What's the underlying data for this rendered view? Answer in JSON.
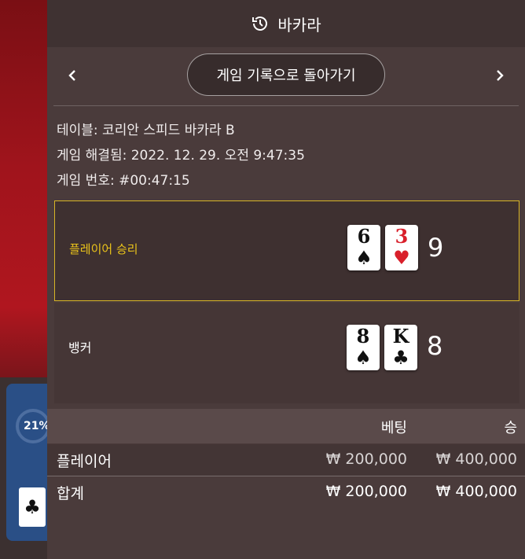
{
  "header": {
    "title": "바카라",
    "icon": "history-icon"
  },
  "nav": {
    "back_label": "게임 기록으로 돌아가기",
    "prev_icon": "chevron-left-icon",
    "next_icon": "chevron-right-icon"
  },
  "info": {
    "table": "테이블: 코리안 스피드 바카라 B",
    "resolved": "게임 해결됨: 2022. 12. 29. 오전 9:47:35",
    "game_number": "게임 번호: #00:47:15"
  },
  "player": {
    "label": "플레이어 승리",
    "cards": [
      {
        "rank": "6",
        "suit": "♠"
      },
      {
        "rank": "3",
        "suit": "♥"
      }
    ],
    "total": "9"
  },
  "banker": {
    "label": "뱅커",
    "cards": [
      {
        "rank": "8",
        "suit": "♠"
      },
      {
        "rank": "K",
        "suit": "♣"
      }
    ],
    "total": "8"
  },
  "bets": {
    "col_bet": "베팅",
    "col_win": "승",
    "rows": [
      {
        "label": "플레이어",
        "bet": "₩ 200,000",
        "win": "₩ 400,000"
      },
      {
        "label": "합계",
        "bet": "₩ 200,000",
        "win": "₩ 400,000"
      }
    ]
  },
  "background": {
    "percent": "21%",
    "card_suit": "♣"
  },
  "colors": {
    "winner_border": "#d8b526",
    "winner_text": "#e9c21a",
    "red_suit": "#d9202b"
  }
}
